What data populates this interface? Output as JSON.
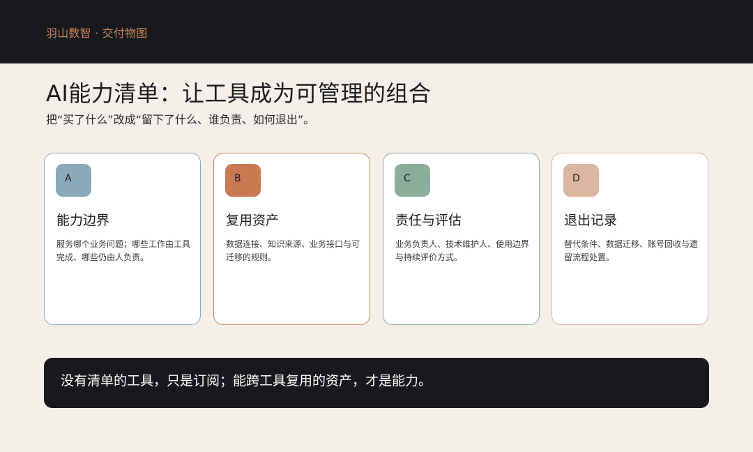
{
  "header": {
    "brand": "羽山数智 · 交付物图"
  },
  "main": {
    "title": "AI能力清单：让工具成为可管理的组合",
    "subtitle": "把“买了什么”改成“留下了什么、谁负责、如何退出”。"
  },
  "cards": [
    {
      "letter": "A",
      "title": "能力边界",
      "desc": "服务哪个业务问题；哪些工作由工具完成、哪些仍由人负责。",
      "accent": "#8aa9ba"
    },
    {
      "letter": "B",
      "title": "复用资产",
      "desc": "数据连接、知识来源、业务接口与可迁移的规则。",
      "accent": "#c97a52"
    },
    {
      "letter": "C",
      "title": "责任与评估",
      "desc": "业务负责人、技术维护人、使用边界与持续评价方式。",
      "accent": "#8aae9a"
    },
    {
      "letter": "D",
      "title": "退出记录",
      "desc": "替代条件、数据迁移、账号回收与遗留流程处置。",
      "accent": "#dcb6a0"
    }
  ],
  "footer": {
    "quote": "没有清单的工具，只是订阅；能跨工具复用的资产，才是能力。"
  },
  "colors": {
    "dark": "#18191c",
    "background": "#f4efe8",
    "brand": "#c9855a"
  }
}
